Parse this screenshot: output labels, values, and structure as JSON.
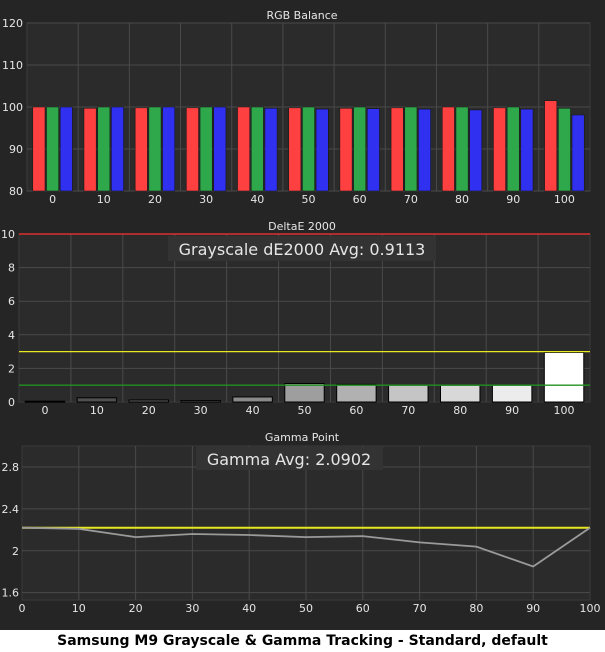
{
  "footer": "Samsung M9 Grayscale & Gamma Tracking - Standard, default",
  "colors": {
    "background": "#252525",
    "plot_background": "#2b2b2b",
    "grid": "#4a4a4a",
    "axis_text": "#e6e6e6",
    "red": "#ff4040",
    "green": "#2ea84a",
    "blue": "#3030f0",
    "threshold_red": "#ff3030",
    "threshold_yellow": "#e8e820",
    "threshold_green": "#209020",
    "gamma_target": "#e8e820",
    "gamma_line": "#9a9a9a"
  },
  "chart_data": [
    {
      "type": "bar",
      "title": "RGB Balance",
      "categories": [
        "0",
        "10",
        "20",
        "30",
        "40",
        "50",
        "60",
        "70",
        "80",
        "90",
        "100"
      ],
      "ylim": [
        80,
        120
      ],
      "yticks": [
        80,
        90,
        100,
        110,
        120
      ],
      "grid": true,
      "series": [
        {
          "color": "red",
          "values": [
            100,
            99.7,
            99.8,
            99.8,
            100,
            99.8,
            99.7,
            99.8,
            100,
            99.8,
            101.5
          ]
        },
        {
          "color": "green",
          "values": [
            100,
            100,
            100,
            100,
            100,
            100,
            100,
            100,
            100,
            100,
            99.7
          ]
        },
        {
          "color": "blue",
          "values": [
            100,
            100,
            100,
            100,
            99.7,
            99.5,
            99.6,
            99.5,
            99.3,
            99.5,
            98.1
          ]
        }
      ]
    },
    {
      "type": "bar",
      "title": "DeltaE 2000",
      "annotation": "Grayscale dE2000 Avg: 0.9113",
      "categories": [
        "0",
        "10",
        "20",
        "30",
        "40",
        "50",
        "60",
        "70",
        "80",
        "90",
        "100"
      ],
      "values": [
        0.05,
        0.25,
        0.12,
        0.08,
        0.3,
        1.1,
        1.05,
        1.0,
        1.0,
        1.0,
        2.95
      ],
      "ylim": [
        0,
        10
      ],
      "yticks": [
        0,
        2,
        4,
        6,
        8,
        10
      ],
      "thresholds": [
        {
          "value": 10,
          "color": "threshold_red"
        },
        {
          "value": 3,
          "color": "threshold_yellow"
        },
        {
          "value": 1,
          "color": "threshold_green"
        }
      ],
      "grid": true
    },
    {
      "type": "line",
      "title": "Gamma Point",
      "annotation": "Gamma Avg: 2.0902",
      "x": [
        0,
        10,
        20,
        30,
        40,
        50,
        60,
        70,
        80,
        90,
        100
      ],
      "xticks": [
        0,
        10,
        20,
        30,
        40,
        50,
        60,
        70,
        80,
        90,
        100
      ],
      "series": [
        {
          "color": "gamma_target",
          "values": [
            2.22,
            2.22,
            2.22,
            2.22,
            2.22,
            2.22,
            2.22,
            2.22,
            2.22,
            2.22,
            2.22
          ]
        },
        {
          "color": "gamma_line",
          "values": [
            2.22,
            2.21,
            2.13,
            2.16,
            2.15,
            2.13,
            2.14,
            2.08,
            2.04,
            1.85,
            2.22
          ]
        }
      ],
      "xlim": [
        0,
        100
      ],
      "ylim": [
        1.53,
        3.0
      ],
      "yticks": [
        1.6,
        2,
        2.4,
        2.8
      ],
      "ytick_labels": [
        "1.6",
        "2",
        "2.4",
        "2.8"
      ],
      "grid": true
    }
  ]
}
